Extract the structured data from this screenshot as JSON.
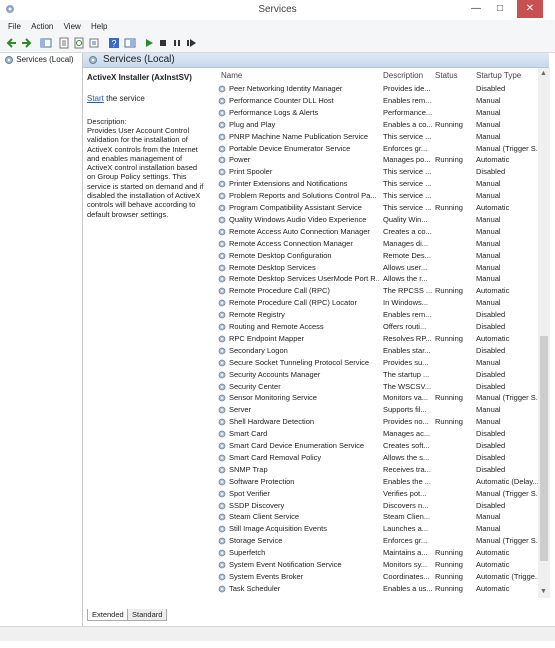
{
  "window": {
    "title": "Services",
    "minimize": "—",
    "maximize": "□",
    "close": "✕"
  },
  "menu": [
    "File",
    "Action",
    "View",
    "Help"
  ],
  "tree": {
    "item": "Services (Local)"
  },
  "header": {
    "title": "Services (Local)"
  },
  "detail": {
    "service_name": "ActiveX Installer (AxInstSV)",
    "start_link": "Start",
    "start_suffix": " the service",
    "desc_label": "Description:",
    "desc_text": "Provides User Account Control validation for the installation of ActiveX controls from the Internet and enables management of ActiveX control installation based on Group Policy settings. This service is started on demand and if disabled the installation of ActiveX controls will behave according to default browser settings."
  },
  "columns": {
    "name": "Name",
    "description": "Description",
    "status": "Status",
    "startup": "Startup Type"
  },
  "rows": [
    [
      "Peer Networking Identity Manager",
      "Provides ide...",
      "",
      "Disabled"
    ],
    [
      "Performance Counter DLL Host",
      "Enables rem...",
      "",
      "Manual"
    ],
    [
      "Performance Logs & Alerts",
      "Performance...",
      "",
      "Manual"
    ],
    [
      "Plug and Play",
      "Enables a co...",
      "Running",
      "Manual"
    ],
    [
      "PNRP Machine Name Publication Service",
      "This service ...",
      "",
      "Manual"
    ],
    [
      "Portable Device Enumerator Service",
      "Enforces gr...",
      "",
      "Manual (Trigger S..."
    ],
    [
      "Power",
      "Manages po...",
      "Running",
      "Automatic"
    ],
    [
      "Print Spooler",
      "This service ...",
      "",
      "Disabled"
    ],
    [
      "Printer Extensions and Notifications",
      "This service ...",
      "",
      "Manual"
    ],
    [
      "Problem Reports and Solutions Control Pa...",
      "This service ...",
      "",
      "Manual"
    ],
    [
      "Program Compatibility Assistant Service",
      "This service ...",
      "Running",
      "Automatic"
    ],
    [
      "Quality Windows Audio Video Experience",
      "Quality Win...",
      "",
      "Manual"
    ],
    [
      "Remote Access Auto Connection Manager",
      "Creates a co...",
      "",
      "Manual"
    ],
    [
      "Remote Access Connection Manager",
      "Manages di...",
      "",
      "Manual"
    ],
    [
      "Remote Desktop Configuration",
      "Remote Des...",
      "",
      "Manual"
    ],
    [
      "Remote Desktop Services",
      "Allows user...",
      "",
      "Manual"
    ],
    [
      "Remote Desktop Services UserMode Port R...",
      "Allows the r...",
      "",
      "Manual"
    ],
    [
      "Remote Procedure Call (RPC)",
      "The RPCSS ...",
      "Running",
      "Automatic"
    ],
    [
      "Remote Procedure Call (RPC) Locator",
      "In Windows...",
      "",
      "Manual"
    ],
    [
      "Remote Registry",
      "Enables rem...",
      "",
      "Disabled"
    ],
    [
      "Routing and Remote Access",
      "Offers routi...",
      "",
      "Disabled"
    ],
    [
      "RPC Endpoint Mapper",
      "Resolves RP...",
      "Running",
      "Automatic"
    ],
    [
      "Secondary Logon",
      "Enables star...",
      "",
      "Disabled"
    ],
    [
      "Secure Socket Tunneling Protocol Service",
      "Provides su...",
      "",
      "Manual"
    ],
    [
      "Security Accounts Manager",
      "The startup ...",
      "",
      "Disabled"
    ],
    [
      "Security Center",
      "The WSCSV...",
      "",
      "Disabled"
    ],
    [
      "Sensor Monitoring Service",
      "Monitors va...",
      "Running",
      "Manual (Trigger S..."
    ],
    [
      "Server",
      "Supports fil...",
      "",
      "Manual"
    ],
    [
      "Shell Hardware Detection",
      "Provides no...",
      "Running",
      "Manual"
    ],
    [
      "Smart Card",
      "Manages ac...",
      "",
      "Disabled"
    ],
    [
      "Smart Card Device Enumeration Service",
      "Creates soft...",
      "",
      "Disabled"
    ],
    [
      "Smart Card Removal Policy",
      "Allows the s...",
      "",
      "Disabled"
    ],
    [
      "SNMP Trap",
      "Receives tra...",
      "",
      "Disabled"
    ],
    [
      "Software Protection",
      "Enables the ...",
      "",
      "Automatic (Delay..."
    ],
    [
      "Spot Verifier",
      "Verifies pot...",
      "",
      "Manual (Trigger S..."
    ],
    [
      "SSDP Discovery",
      "Discovers n...",
      "",
      "Disabled"
    ],
    [
      "Steam Client Service",
      "Steam Clien...",
      "",
      "Manual"
    ],
    [
      "Still Image Acquisition Events",
      "Launches a...",
      "",
      "Manual"
    ],
    [
      "Storage Service",
      "Enforces gr...",
      "",
      "Manual (Trigger S..."
    ],
    [
      "Superfetch",
      "Maintains a...",
      "Running",
      "Automatic"
    ],
    [
      "System Event Notification Service",
      "Monitors sy...",
      "Running",
      "Automatic"
    ],
    [
      "System Events Broker",
      "Coordinates...",
      "Running",
      "Automatic (Trigge..."
    ],
    [
      "Task Scheduler",
      "Enables a us...",
      "Running",
      "Automatic"
    ]
  ],
  "tabs": {
    "extended": "Extended",
    "standard": "Standard"
  }
}
